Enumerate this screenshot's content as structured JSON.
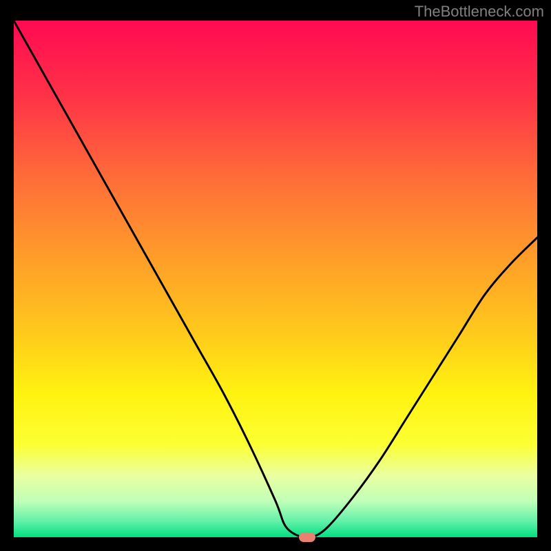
{
  "attribution": "TheBottleneck.com",
  "chart_data": {
    "type": "line",
    "title": "",
    "xlabel": "",
    "ylabel": "",
    "xlim": [
      0,
      100
    ],
    "ylim": [
      0,
      100
    ],
    "series": [
      {
        "name": "bottleneck-curve",
        "x": [
          0,
          5,
          10,
          15,
          20,
          25,
          30,
          35,
          40,
          45,
          50,
          52,
          55,
          57,
          60,
          65,
          70,
          75,
          80,
          85,
          90,
          95,
          100
        ],
        "y": [
          100,
          91,
          82,
          73,
          64,
          55,
          46,
          37,
          28,
          18,
          7,
          2,
          0,
          0,
          2,
          8,
          15,
          23,
          31,
          39,
          47,
          53,
          58
        ]
      }
    ],
    "marker": {
      "x": 56,
      "y": 0
    },
    "gradient_stops": [
      {
        "pos": 0.0,
        "color": "#ff0a52"
      },
      {
        "pos": 0.15,
        "color": "#ff3347"
      },
      {
        "pos": 0.3,
        "color": "#ff6b39"
      },
      {
        "pos": 0.45,
        "color": "#ff9a2a"
      },
      {
        "pos": 0.6,
        "color": "#ffc81c"
      },
      {
        "pos": 0.72,
        "color": "#fff210"
      },
      {
        "pos": 0.82,
        "color": "#fcff32"
      },
      {
        "pos": 0.88,
        "color": "#eaffa0"
      },
      {
        "pos": 0.93,
        "color": "#c0ffb8"
      },
      {
        "pos": 0.97,
        "color": "#60f0a8"
      },
      {
        "pos": 1.0,
        "color": "#00e080"
      }
    ]
  }
}
